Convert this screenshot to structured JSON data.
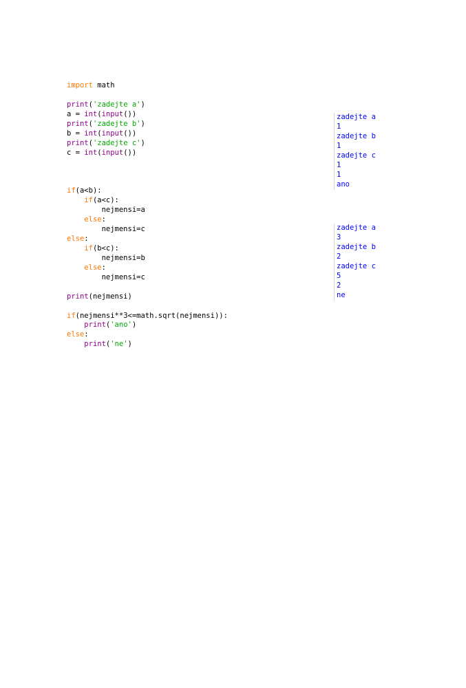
{
  "code": {
    "lines": [
      [
        {
          "t": "import",
          "c": "kw"
        },
        {
          "t": " math",
          "c": ""
        }
      ],
      [],
      [
        {
          "t": "print",
          "c": "bi"
        },
        {
          "t": "(",
          "c": ""
        },
        {
          "t": "'zadejte a'",
          "c": "str"
        },
        {
          "t": ")",
          "c": ""
        }
      ],
      [
        {
          "t": "a = ",
          "c": ""
        },
        {
          "t": "int",
          "c": "bi"
        },
        {
          "t": "(",
          "c": ""
        },
        {
          "t": "input",
          "c": "bi"
        },
        {
          "t": "())",
          "c": ""
        }
      ],
      [
        {
          "t": "print",
          "c": "bi"
        },
        {
          "t": "(",
          "c": ""
        },
        {
          "t": "'zadejte b'",
          "c": "str"
        },
        {
          "t": ")",
          "c": ""
        }
      ],
      [
        {
          "t": "b = ",
          "c": ""
        },
        {
          "t": "int",
          "c": "bi"
        },
        {
          "t": "(",
          "c": ""
        },
        {
          "t": "input",
          "c": "bi"
        },
        {
          "t": "())",
          "c": ""
        }
      ],
      [
        {
          "t": "print",
          "c": "bi"
        },
        {
          "t": "(",
          "c": ""
        },
        {
          "t": "'zadejte c'",
          "c": "str"
        },
        {
          "t": ")",
          "c": ""
        }
      ],
      [
        {
          "t": "c = ",
          "c": ""
        },
        {
          "t": "int",
          "c": "bi"
        },
        {
          "t": "(",
          "c": ""
        },
        {
          "t": "input",
          "c": "bi"
        },
        {
          "t": "())",
          "c": ""
        }
      ],
      [],
      [],
      [],
      [
        {
          "t": "if",
          "c": "kw"
        },
        {
          "t": "(a<b):",
          "c": ""
        }
      ],
      [
        {
          "t": "    ",
          "c": ""
        },
        {
          "t": "if",
          "c": "kw"
        },
        {
          "t": "(a<c):",
          "c": ""
        }
      ],
      [
        {
          "t": "        nejmensi=a",
          "c": ""
        }
      ],
      [
        {
          "t": "    ",
          "c": ""
        },
        {
          "t": "else",
          "c": "kw"
        },
        {
          "t": ":",
          "c": ""
        }
      ],
      [
        {
          "t": "        nejmensi=c",
          "c": ""
        }
      ],
      [
        {
          "t": "else",
          "c": "kw"
        },
        {
          "t": ":",
          "c": ""
        }
      ],
      [
        {
          "t": "    ",
          "c": ""
        },
        {
          "t": "if",
          "c": "kw"
        },
        {
          "t": "(b<c):",
          "c": ""
        }
      ],
      [
        {
          "t": "        nejmensi=b",
          "c": ""
        }
      ],
      [
        {
          "t": "    ",
          "c": ""
        },
        {
          "t": "else",
          "c": "kw"
        },
        {
          "t": ":",
          "c": ""
        }
      ],
      [
        {
          "t": "        nejmensi=c",
          "c": ""
        }
      ],
      [],
      [
        {
          "t": "print",
          "c": "bi"
        },
        {
          "t": "(nejmensi)",
          "c": ""
        }
      ],
      [],
      [
        {
          "t": "if",
          "c": "kw"
        },
        {
          "t": "(nejmensi**3<=math.sqrt(nejmensi)):",
          "c": ""
        }
      ],
      [
        {
          "t": "    ",
          "c": ""
        },
        {
          "t": "print",
          "c": "bi"
        },
        {
          "t": "(",
          "c": ""
        },
        {
          "t": "'ano'",
          "c": "str"
        },
        {
          "t": ")",
          "c": ""
        }
      ],
      [
        {
          "t": "else",
          "c": "kw"
        },
        {
          "t": ":",
          "c": ""
        }
      ],
      [
        {
          "t": "    ",
          "c": ""
        },
        {
          "t": "print",
          "c": "bi"
        },
        {
          "t": "(",
          "c": ""
        },
        {
          "t": "'ne'",
          "c": "str"
        },
        {
          "t": ")",
          "c": ""
        }
      ]
    ]
  },
  "outputs": [
    {
      "lines": [
        "zadejte a",
        "1",
        "zadejte b",
        "1",
        "zadejte c",
        "1",
        "1",
        "ano"
      ]
    },
    {
      "lines": [
        "zadejte a",
        "3",
        "zadejte b",
        "2",
        "zadejte c",
        "5",
        "2",
        "ne"
      ]
    }
  ]
}
